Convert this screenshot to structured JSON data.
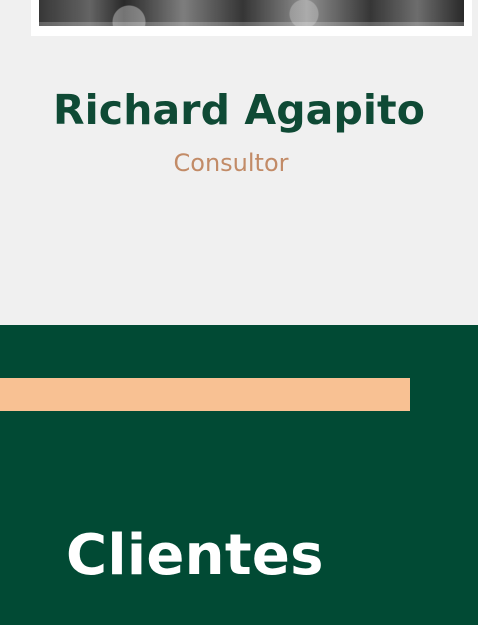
{
  "profile": {
    "name": "Richard Agapito",
    "role": "Consultor"
  },
  "section": {
    "title": "Clientes"
  },
  "colors": {
    "background_light": "#f0f0f0",
    "name_green": "#0f4a35",
    "role_tan": "#c28b67",
    "section_green": "#014a34",
    "accent_peach": "#f8c193",
    "title_white": "#ffffff"
  },
  "icons": {
    "profile_photo": "profile-photo"
  }
}
